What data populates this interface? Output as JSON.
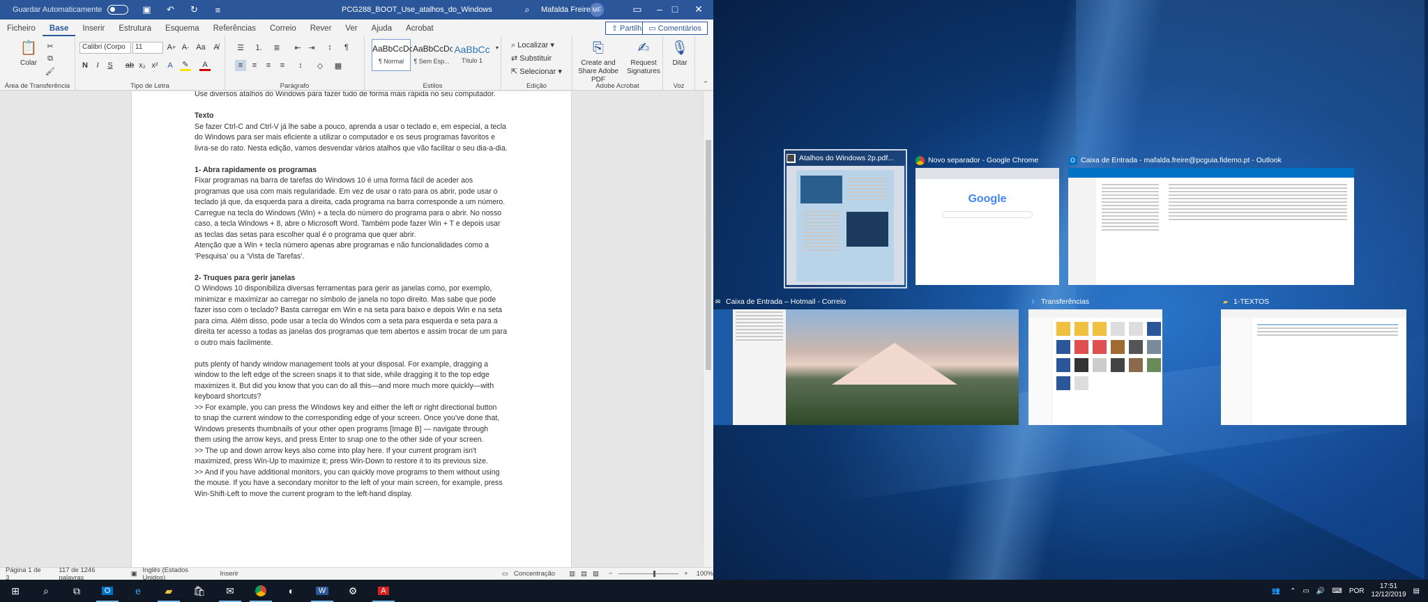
{
  "word": {
    "autosave_label": "Guardar Automaticamente",
    "doc_title": "PCG288_BOOT_Use_atalhos_do_Windows",
    "user_name": "Mafalda Freire",
    "user_initials": "MF",
    "tabs": [
      "Ficheiro",
      "Base",
      "Inserir",
      "Estrutura",
      "Esquema",
      "Referências",
      "Correio",
      "Rever",
      "Ver",
      "Ajuda",
      "Acrobat"
    ],
    "share_label": "Partilhar",
    "comments_label": "Comentários",
    "ribbon": {
      "paste_label": "Colar",
      "clipboard_group": "Área de Transferência",
      "font_name": "Calibri (Corpo",
      "font_size": "11",
      "font_group": "Tipo de Letra",
      "paragraph_group": "Parágrafo",
      "styles": [
        {
          "preview": "AaBbCcDc",
          "name": "¶ Normal"
        },
        {
          "preview": "AaBbCcDc",
          "name": "¶ Sem Esp..."
        },
        {
          "preview": "AaBbCc",
          "name": "Título 1"
        }
      ],
      "styles_group": "Estilos",
      "find_label": "Localizar",
      "replace_label": "Substituir",
      "select_label": "Selecionar",
      "editing_group": "Edição",
      "create_share_pdf": "Create and Share Adobe PDF",
      "request_signatures": "Request Signatures",
      "acrobat_group": "Adobe Acrobat",
      "dictate_label": "Ditar",
      "voice_group": "Voz"
    },
    "document": {
      "lines": [
        {
          "t": "Use diversos atalhos do Windows para fazer tudo de forma mais rápida no seu computador.",
          "b": false
        },
        {
          "t": "",
          "b": false
        },
        {
          "t": "Texto",
          "b": true
        },
        {
          "t": "Se fazer Ctrl-C and Ctrl-V já lhe sabe a pouco, aprenda a usar o teclado e, em especial, a tecla",
          "b": false
        },
        {
          "t": "do Windows para ser mais eficiente a utilizar o computador e os seus programas favoritos e",
          "b": false
        },
        {
          "t": "livra-se do rato. Nesta edição, vamos desvendar vários atalhos que vão facilitar o seu dia-a-dia.",
          "b": false
        },
        {
          "t": "",
          "b": false
        },
        {
          "t": "1- Abra rapidamente os programas",
          "b": true
        },
        {
          "t": "Fixar programas na barra de tarefas do Windows 10 é uma forma fácil de aceder aos",
          "b": false
        },
        {
          "t": "programas que usa com mais regularidade. Em vez de usar o rato para os abrir, pode usar o",
          "b": false
        },
        {
          "t": "teclado já que, da esquerda para a direita, cada programa na barra corresponde a um número.",
          "b": false
        },
        {
          "t": "Carregue na tecla do Windows (Win) + a tecla do número do programa para o abrir. No nosso",
          "b": false
        },
        {
          "t": "caso, a tecla Windows + 8, abre o Microsoft Word. Também pode fazer Win + T e depois usar",
          "b": false
        },
        {
          "t": "as teclas das setas para escolher qual é o programa que quer abrir.",
          "b": false
        },
        {
          "t": "Atenção que a Win + tecla número apenas abre programas e não funcionalidades como a",
          "b": false
        },
        {
          "t": "‘Pesquisa’ ou a ‘Vista de Tarefas’.",
          "b": false
        },
        {
          "t": "",
          "b": false
        },
        {
          "t": "2- Truques para gerir janelas",
          "b": true
        },
        {
          "t": "O Windows 10 disponibiliza diversas ferramentas para gerir as janelas como, por exemplo,",
          "b": false
        },
        {
          "t": "minimizar e maximizar ao carregar no símbolo de janela no topo direito. Mas sabe que pode",
          "b": false
        },
        {
          "t": "fazer isso com o teclado? Basta carregar em Win e na seta para baixo e depois Win e na seta",
          "b": false
        },
        {
          "t": "para cima. Além disso, pode usar a tecla do Windos com a seta para esquerda e seta para a",
          "b": false
        },
        {
          "t": "direita ter acesso a todas as janelas dos programas que tem abertos e assim trocar de um para",
          "b": false
        },
        {
          "t": "o outro mais facilmente.",
          "b": false
        },
        {
          "t": "",
          "b": false
        },
        {
          "t": "puts plenty of handy window management tools at your disposal. For example, dragging a",
          "b": false
        },
        {
          "t": "window to the left edge of the screen snaps it to that side, while dragging it to the top edge",
          "b": false
        },
        {
          "t": "maximizes it. But did you know that you can do all this—and more much more quickly—with",
          "b": false
        },
        {
          "t": "keyboard shortcuts?",
          "b": false
        },
        {
          "t": ">> For example, you can press the Windows key and either the left or right directional button",
          "b": false
        },
        {
          "t": "to snap the current window to the corresponding edge of your screen. Once you've done that,",
          "b": false
        },
        {
          "t": "Windows presents thumbnails of your other open programs [Image B] — navigate through",
          "b": false
        },
        {
          "t": "them using the arrow keys, and press Enter to snap one to the other side of your screen.",
          "b": false
        },
        {
          "t": ">> The up and down arrow keys also come into play here. If your current program isn't",
          "b": false
        },
        {
          "t": "maximized, press Win-Up to maximize it; press Win-Down to restore it to its previous size.",
          "b": false
        },
        {
          "t": ">> And if you have additional monitors, you can quickly move programs to them without using",
          "b": false
        },
        {
          "t": "the mouse. If you have a secondary monitor to the left of your main screen, for example, press",
          "b": false
        },
        {
          "t": "Win-Shift-Left to move the current program to the left-hand display.",
          "b": false
        }
      ]
    },
    "status": {
      "page": "Página 1 de 3",
      "words": "117 de 1246 palavras",
      "language": "Inglês (Estados Unidos)",
      "mode": "Inserir",
      "focus": "Concentração",
      "zoom": "100%"
    }
  },
  "snap_thumbnails": [
    {
      "title": "Atalhos do Windows 2p.pdf...",
      "icon": "pdf-icon"
    },
    {
      "title": "Novo separador - Google Chrome",
      "icon": "chrome-icon"
    },
    {
      "title": "Caixa de Entrada - mafalda.freire@pcguia.fidemo.pt - Outlook",
      "icon": "outlook-icon"
    },
    {
      "title": "Caixa de Entrada – Hotmail - Correio",
      "icon": "mail-icon"
    },
    {
      "title": "Transferências",
      "icon": "download-icon"
    },
    {
      "title": "1-TEXTOS",
      "icon": "folder-icon"
    }
  ],
  "google_logo": "Google",
  "taskbar": {
    "language": "POR",
    "time": "17:51",
    "date": "12/12/2019"
  },
  "colors": {
    "word_blue": "#2b579a",
    "taskbar": "#0f1824",
    "desktop": "#1b5ba8"
  }
}
